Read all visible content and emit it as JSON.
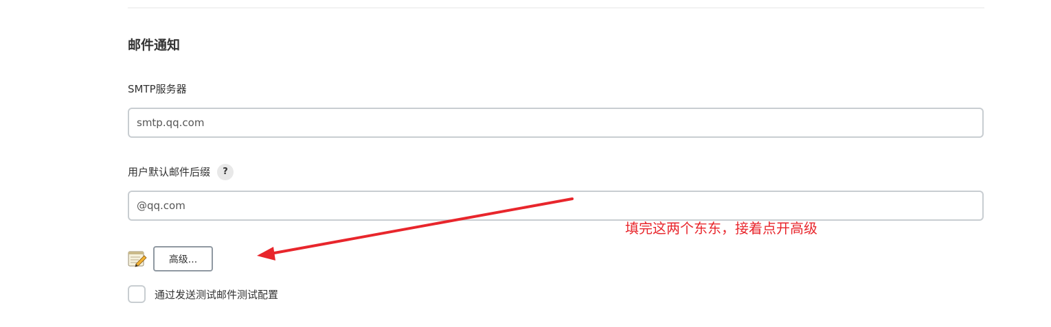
{
  "section": {
    "title": "邮件通知"
  },
  "smtp": {
    "label": "SMTP服务器",
    "value": "smtp.qq.com"
  },
  "suffix": {
    "label": "用户默认邮件后缀",
    "help_glyph": "?",
    "value": "@qq.com"
  },
  "advanced": {
    "icon": "notepad-icon",
    "label": "高级..."
  },
  "test_option": {
    "label": "通过发送测试邮件测试配置",
    "checked": false
  },
  "annotation": {
    "text": "填完这两个东东，接着点开高级",
    "color": "#e8262c"
  },
  "colors": {
    "input_border": "#c8cdd1",
    "button_border": "#8f98a1",
    "help_bg": "#e8e8e8"
  }
}
